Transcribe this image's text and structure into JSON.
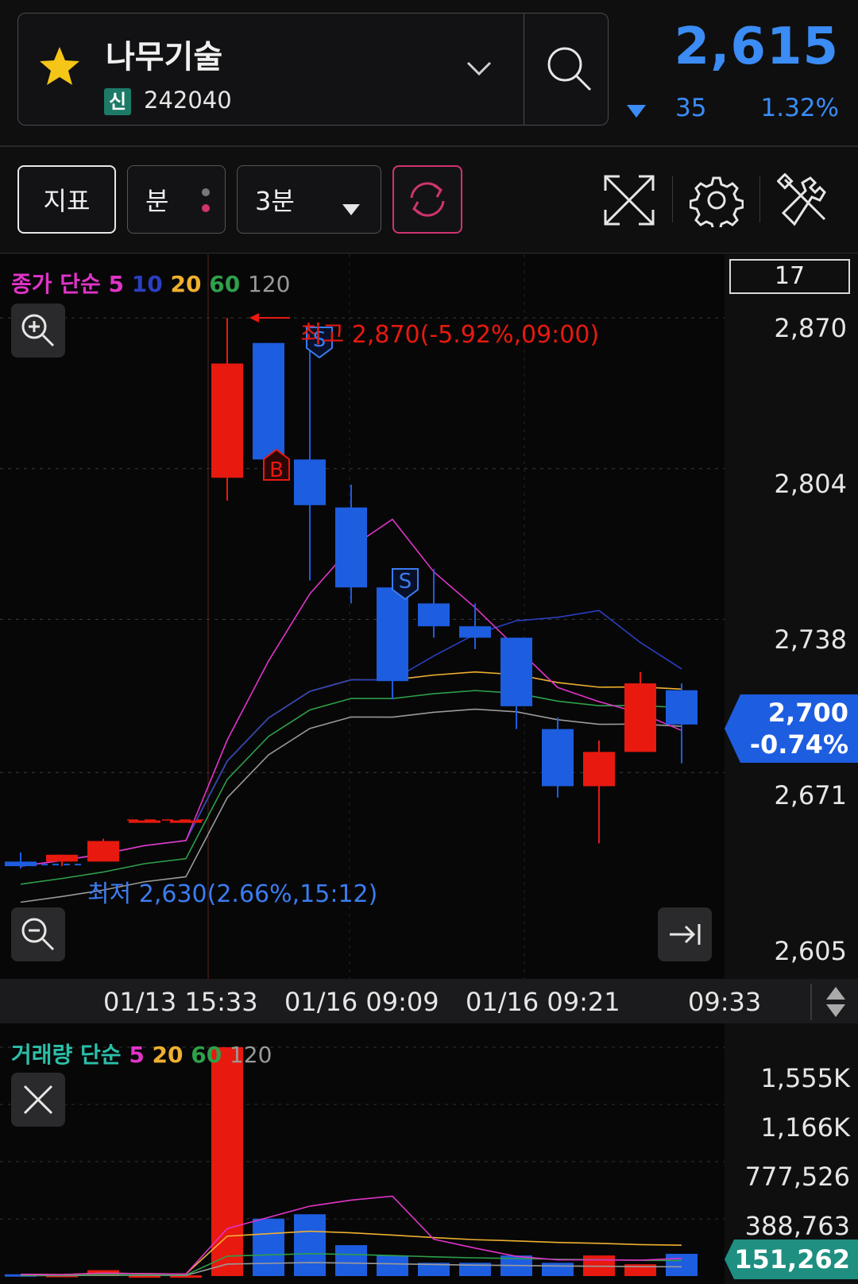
{
  "stock": {
    "name": "나무기술",
    "badge": "신",
    "code": "242040",
    "price": "2,615",
    "change": "35",
    "change_pct": "1.32%"
  },
  "toolbar": {
    "indicator_label": "지표",
    "unit_label": "분",
    "period_label": "3분"
  },
  "price_chart": {
    "ma_legend": {
      "prefix": "종가 단순",
      "p5": "5",
      "p10": "10",
      "p20": "20",
      "p60": "60",
      "p120": "120"
    },
    "visible_count": "17",
    "y_ticks": [
      "2,870",
      "2,804",
      "2,738",
      "2,671",
      "2,605"
    ],
    "current_price": "2,700",
    "current_pct": "-0.74%",
    "high_annotation": "최고 2,870(-5.92%,09:00)",
    "low_annotation": "최저 2,630(2.66%,15:12)",
    "marker_b": "B",
    "marker_s": "S",
    "x_ticks": [
      "01/13 15:33",
      "01/16 09:09",
      "01/16 09:21",
      "09:33"
    ]
  },
  "volume_chart": {
    "legend": {
      "prefix": "거래량 단순",
      "p5": "5",
      "p20": "20",
      "p60": "60",
      "p120": "120"
    },
    "y_ticks": [
      "1,555K",
      "1,166K",
      "777,526",
      "388,763"
    ],
    "current_volume": "151,262"
  },
  "colors": {
    "up": "#e8190f",
    "down": "#1d5de0",
    "ma5": "#e034c8",
    "ma10": "#2a3fc0",
    "ma20": "#f0b030",
    "ma60": "#2ea04a",
    "ma120": "#9a9a9a",
    "accent_blue": "#3b8cf5"
  },
  "chart_data": {
    "type": "candlestick",
    "categories": [
      "c1",
      "c2",
      "c3",
      "01/13 15:33",
      "c5",
      "c6",
      "c7",
      "c8",
      "c9",
      "c10",
      "c11",
      "c12",
      "c13",
      "c14",
      "c15",
      "c16",
      "c17"
    ],
    "ohlc": [
      [
        2632,
        2636,
        2629,
        2630
      ],
      [
        2632,
        2634,
        2630,
        2635
      ],
      [
        2632,
        2642,
        2632,
        2641
      ],
      [
        2650,
        2650,
        2650,
        2650
      ],
      [
        2650,
        2650,
        2650,
        2650
      ],
      [
        2800,
        2870,
        2790,
        2850
      ],
      [
        2859,
        2859,
        2801,
        2808
      ],
      [
        2808,
        2860,
        2755,
        2788
      ],
      [
        2787,
        2797,
        2745,
        2752
      ],
      [
        2752,
        2732,
        2703,
        2711
      ],
      [
        2745,
        2760,
        2730,
        2735
      ],
      [
        2735,
        2745,
        2725,
        2730
      ],
      [
        2730,
        2730,
        2690,
        2700
      ],
      [
        2690,
        2695,
        2660,
        2665
      ],
      [
        2665,
        2685,
        2640,
        2680
      ],
      [
        2680,
        2715,
        2695,
        2710
      ],
      [
        2707,
        2710,
        2675,
        2692
      ]
    ],
    "volume": [
      12000,
      8000,
      40000,
      5000,
      5000,
      1555000,
      390000,
      420000,
      210000,
      140000,
      90000,
      90000,
      140000,
      90000,
      140000,
      80000,
      151262
    ],
    "ylim": [
      2605,
      2870
    ]
  }
}
